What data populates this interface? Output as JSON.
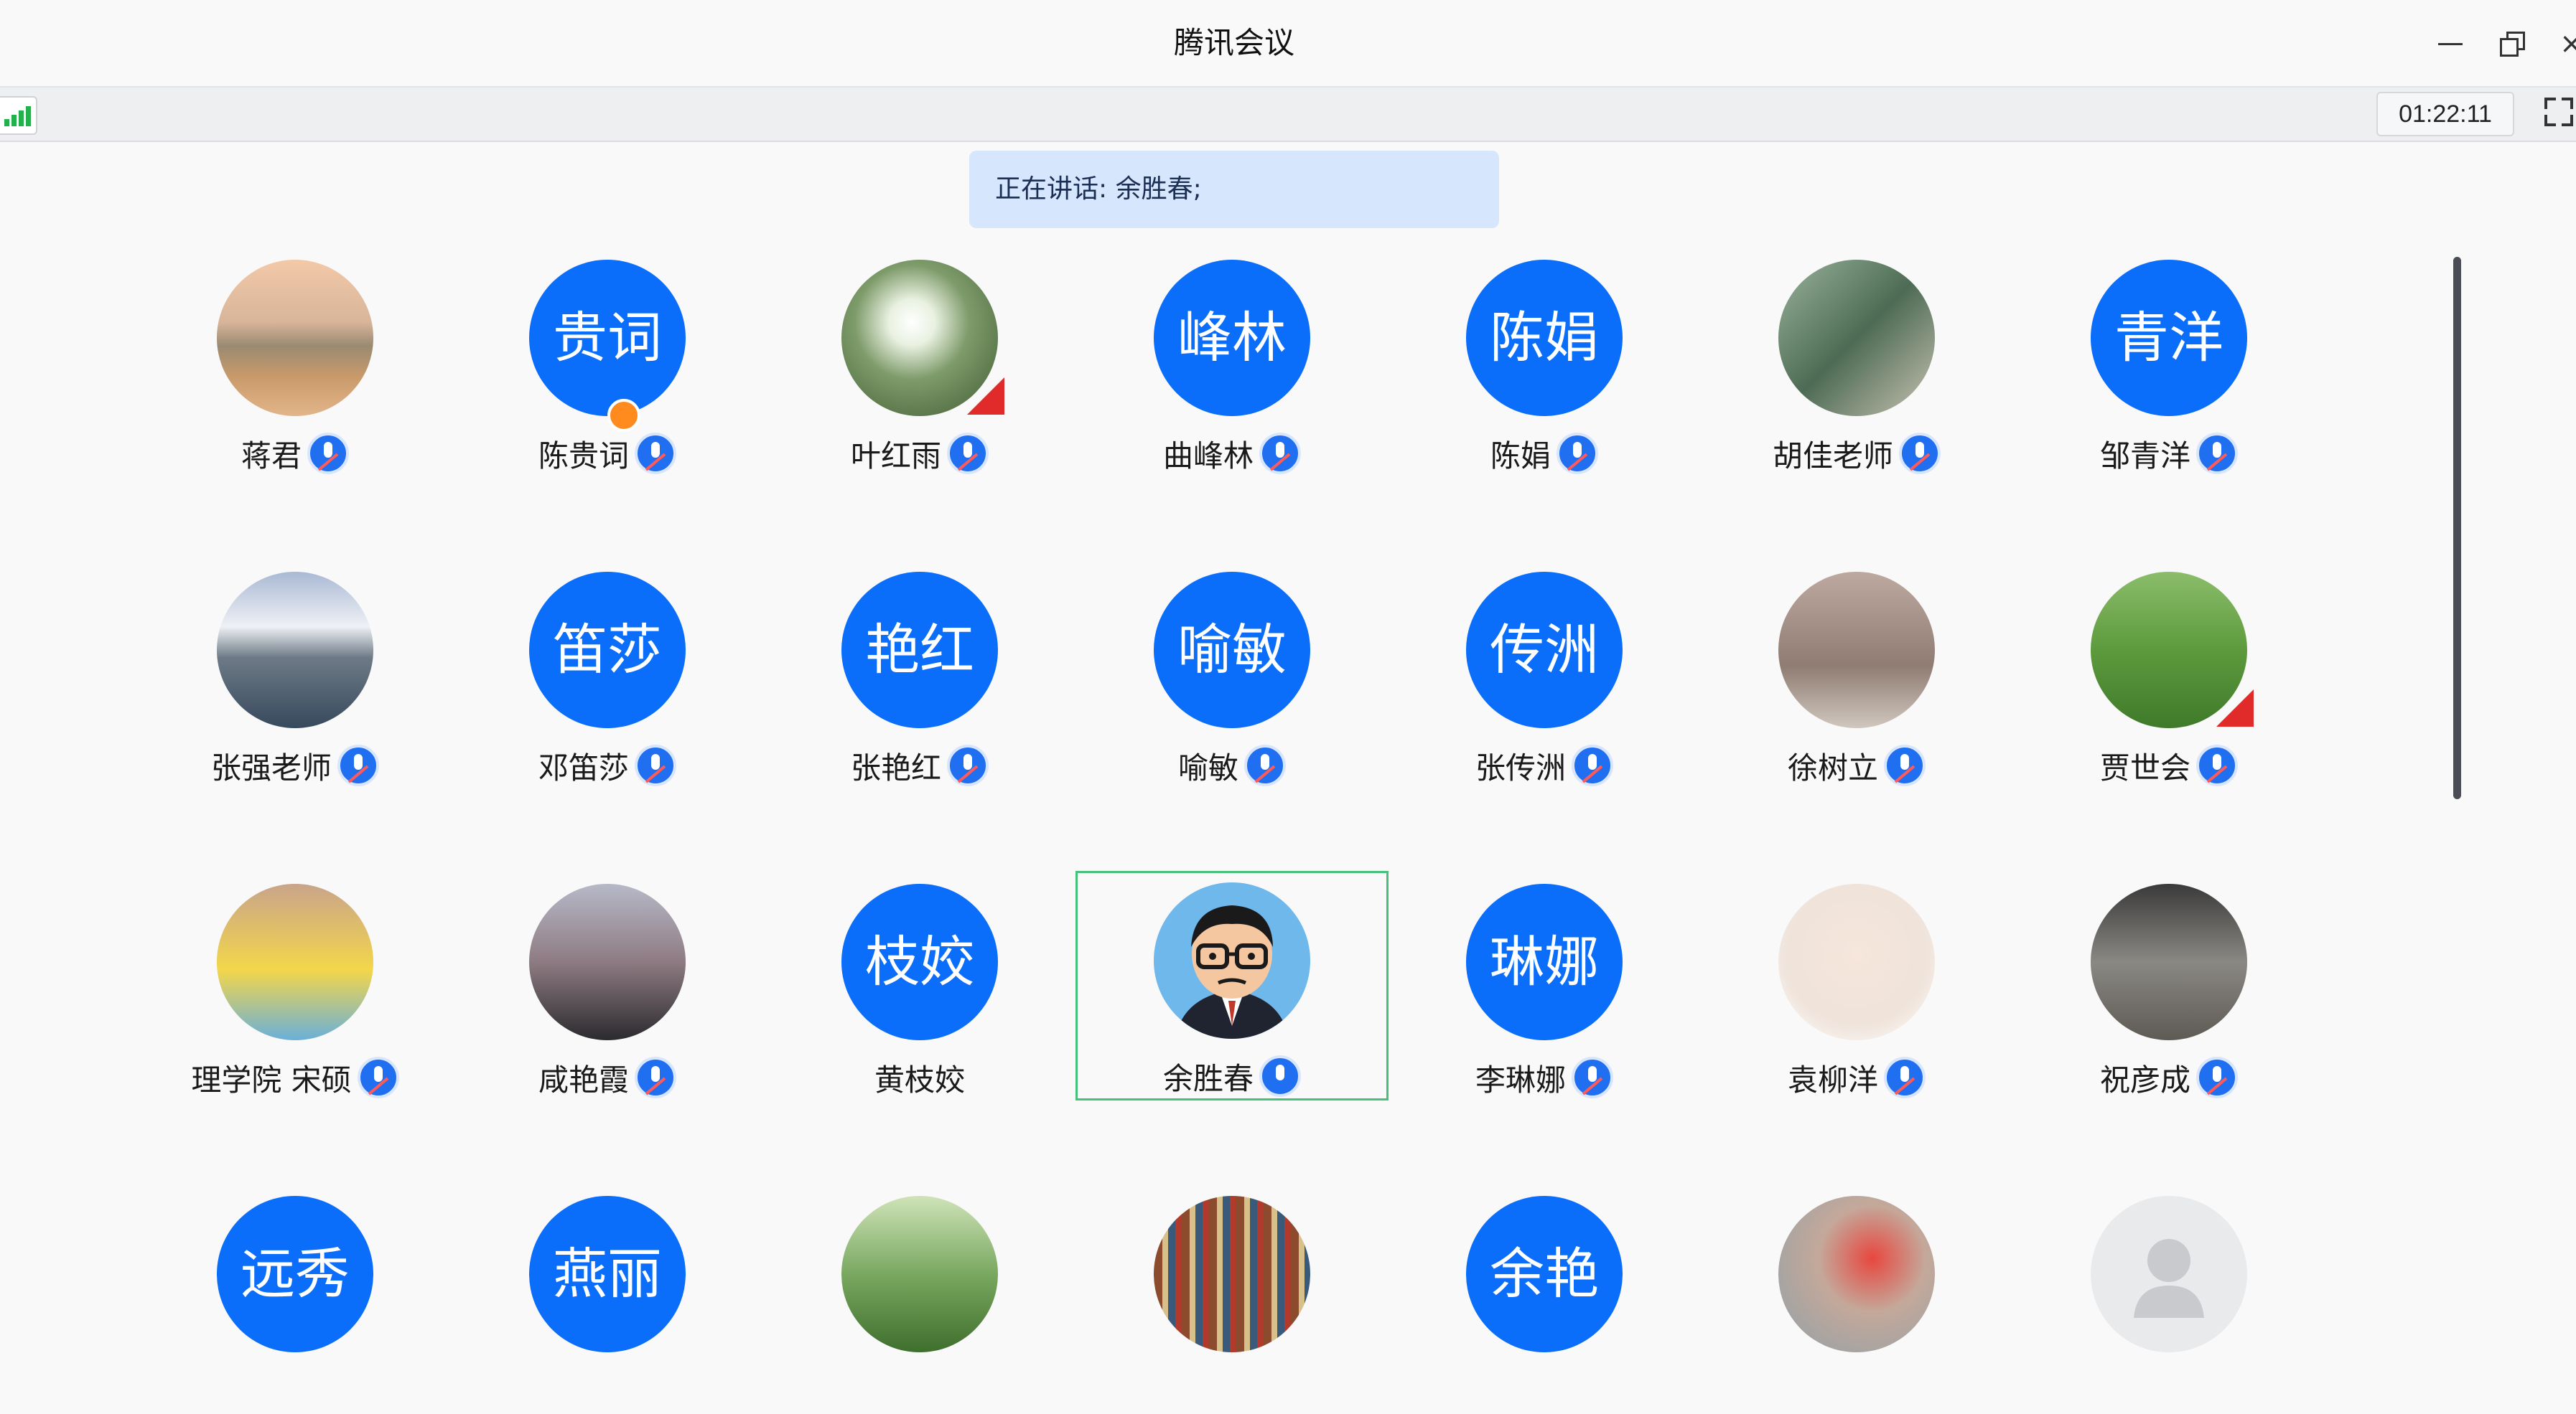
{
  "window": {
    "title": "腾讯会议"
  },
  "toolbar": {
    "timer": "01:22:11"
  },
  "speaking": {
    "text": "正在讲话: 余胜春;"
  },
  "colors": {
    "accent": "#0a6efa",
    "active_border": "#45c27a",
    "speaking_bg": "#d6e7fd"
  },
  "participants": [
    {
      "name": "蒋君",
      "avatar_type": "photo",
      "photo_desc": "building-by-lake",
      "mic": "muted"
    },
    {
      "name": "陈贵词",
      "avatar_text": "贵词",
      "avatar_type": "text",
      "mic": "muted",
      "badge": "host-icon"
    },
    {
      "name": "叶红雨",
      "avatar_type": "photo",
      "photo_desc": "sunlight-through-leaves",
      "mic": "muted",
      "flag": true
    },
    {
      "name": "曲峰林",
      "avatar_text": "峰林",
      "avatar_type": "text",
      "mic": "muted"
    },
    {
      "name": "陈娟",
      "avatar_text": "陈娟",
      "avatar_type": "text",
      "mic": "muted"
    },
    {
      "name": "胡佳老师",
      "avatar_type": "photo",
      "photo_desc": "greenhouse",
      "mic": "muted"
    },
    {
      "name": "邹青洋",
      "avatar_text": "青洋",
      "avatar_type": "text",
      "mic": "muted"
    },
    {
      "name": "张强老师",
      "avatar_type": "photo",
      "photo_desc": "glacier-lake",
      "mic": "muted"
    },
    {
      "name": "邓笛莎",
      "avatar_text": "笛莎",
      "avatar_type": "text",
      "mic": "muted"
    },
    {
      "name": "张艳红",
      "avatar_text": "艳红",
      "avatar_type": "text",
      "mic": "muted"
    },
    {
      "name": "喻敏",
      "avatar_text": "喻敏",
      "avatar_type": "text",
      "mic": "muted"
    },
    {
      "name": "张传洲",
      "avatar_text": "传洲",
      "avatar_type": "text",
      "mic": "muted"
    },
    {
      "name": "徐树立",
      "avatar_type": "photo",
      "photo_desc": "child-at-monument",
      "mic": "muted"
    },
    {
      "name": "贾世会",
      "avatar_type": "photo",
      "photo_desc": "child-on-grass",
      "mic": "muted",
      "flag": true
    },
    {
      "name": "理学院 宋硕",
      "avatar_type": "photo",
      "photo_desc": "child-in-pool",
      "mic": "muted"
    },
    {
      "name": "咸艳霞",
      "avatar_type": "photo",
      "photo_desc": "family-portrait",
      "mic": "muted"
    },
    {
      "name": "黄枝姣",
      "avatar_text": "枝姣",
      "avatar_type": "text",
      "mic": "none"
    },
    {
      "name": "余胜春",
      "avatar_type": "cartoon",
      "mic": "on",
      "active": true
    },
    {
      "name": "李琳娜",
      "avatar_text": "琳娜",
      "avatar_type": "text",
      "mic": "muted"
    },
    {
      "name": "袁柳洋",
      "avatar_type": "photo",
      "photo_desc": "baby",
      "mic": "muted"
    },
    {
      "name": "祝彦成",
      "avatar_type": "photo",
      "photo_desc": "interior",
      "mic": "muted"
    },
    {
      "name": "",
      "avatar_text": "远秀",
      "avatar_type": "text",
      "mic": "none"
    },
    {
      "name": "",
      "avatar_text": "燕丽",
      "avatar_type": "text",
      "mic": "none"
    },
    {
      "name": "",
      "avatar_type": "photo",
      "photo_desc": "lotus",
      "mic": "none"
    },
    {
      "name": "",
      "avatar_type": "photo",
      "photo_desc": "bookshelf",
      "mic": "none"
    },
    {
      "name": "",
      "avatar_text": "余艳",
      "avatar_type": "text",
      "mic": "none"
    },
    {
      "name": "",
      "avatar_type": "photo",
      "photo_desc": "flowers",
      "mic": "none"
    },
    {
      "name": "",
      "avatar_type": "blank",
      "mic": "none"
    }
  ]
}
